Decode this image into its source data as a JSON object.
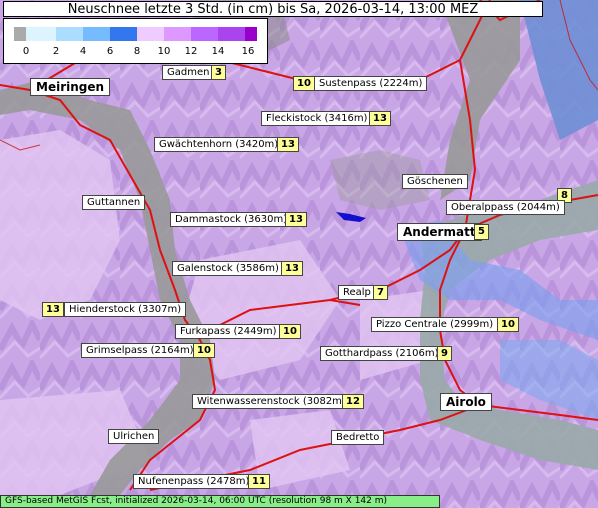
{
  "title": "Neuschnee letzte 3 Std. (in cm) bis Sa, 2026-03-14, 13:00 MEZ",
  "legend": {
    "ticks": [
      "0",
      "2",
      "4",
      "6",
      "8",
      "10",
      "12",
      "14",
      "16"
    ],
    "colors": [
      "#aaaaaa",
      "#ddf4ff",
      "#aaddff",
      "#77bbff",
      "#3377ee",
      "#eeccff",
      "#dd99ff",
      "#bb66ff",
      "#9900cc"
    ]
  },
  "places": {
    "meiringen": "Meiringen",
    "andermatt": "Andermatt",
    "airolo": "Airolo",
    "gadmen": "Gadmen",
    "sustenpass": "Sustenpass (2224m)",
    "fleckistock": "Fleckistock (3416m)",
    "gwaechtenhorn": "Gwächtenhorn (3420m)",
    "goeschenen": "Göschenen",
    "oberalppass": "Oberalppass (2044m)",
    "guttannen": "Guttannen",
    "dammastock": "Dammastock (3630m)",
    "galenstock": "Galenstock (3586m)",
    "realp": "Realp",
    "hienderstock": "Hienderstock (3307m)",
    "pizzo": "Pizzo Centrale (2999m)",
    "furkapass": "Furkapass (2449m)",
    "grimselpass": "Grimselpass (2164m)",
    "gotthardpass": "Gotthardpass (2106m)",
    "witenwasserenstock": "Witenwasserenstock (3082m)",
    "ulrichen": "Ulrichen",
    "bedretto": "Bedretto",
    "nufenenpass": "Nufenenpass (2478m)"
  },
  "values": {
    "gadmen": "3",
    "sustenpass": "10",
    "fleckistock": "13",
    "gwaechtenhorn": "13",
    "oberalppass": "8",
    "andermatt": "5",
    "dammastock": "13",
    "galenstock": "13",
    "realp": "7",
    "hienderstock": "13",
    "pizzo": "10",
    "furkapass": "10",
    "grimselpass": "10",
    "gotthardpass": "9",
    "witenwasserenstock": "12",
    "nufenenpass": "11"
  },
  "footer": "GFS-based MetGIS Fcst, initialized 2026-03-14, 06:00 UTC  (resolution 98 m X 142 m)"
}
